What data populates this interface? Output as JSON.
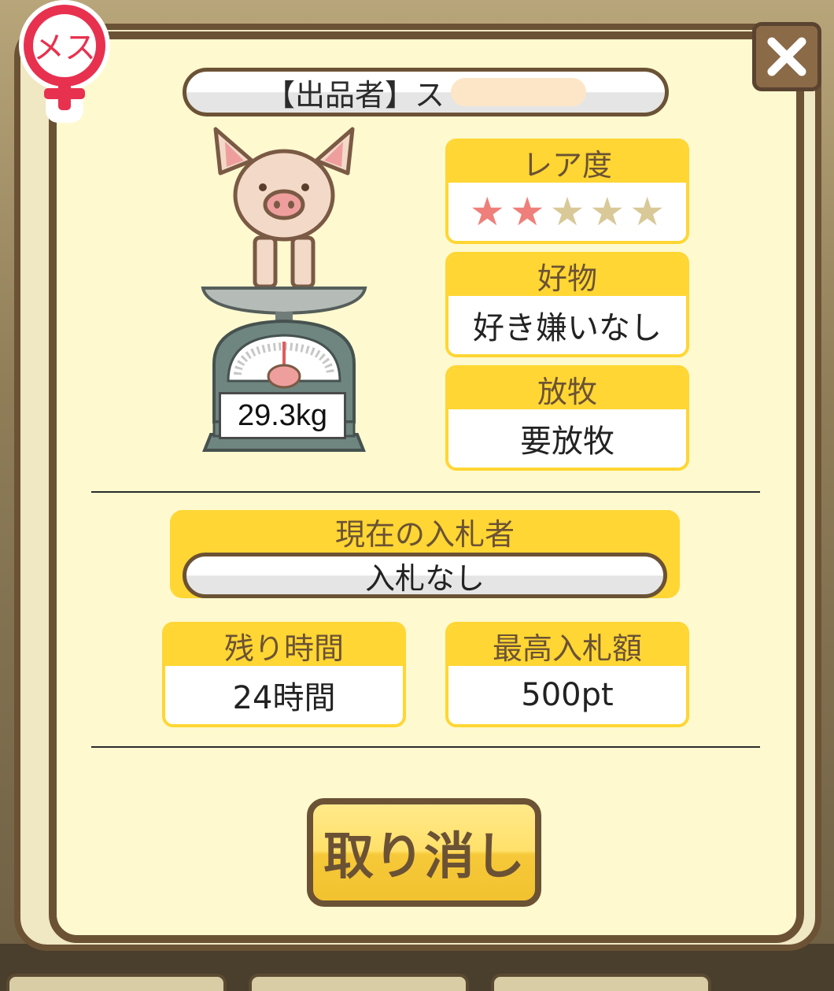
{
  "badge": {
    "label": "メス"
  },
  "seller": {
    "label": "【出品者】ス"
  },
  "weight": "29.3kg",
  "rarity": {
    "title": "レア度",
    "filled": 2,
    "total": 5,
    "star_char": "★"
  },
  "favorite": {
    "title": "好物",
    "value": "好き嫌いなし"
  },
  "grazing": {
    "title": "放牧",
    "value": "要放牧"
  },
  "bidder": {
    "title": "現在の入札者",
    "value": "入札なし"
  },
  "time_left": {
    "title": "残り時間",
    "value": "24時間"
  },
  "max_bid": {
    "title": "最高入札額",
    "value": "500pt"
  },
  "cancel_button": {
    "label": "取り消し"
  },
  "colors": {
    "accent_yellow": "#ffd633",
    "frame_brown": "#6b5235",
    "panel_bg": "#fff9cf",
    "star_on": "#ef7f7a",
    "star_off": "#d9c999",
    "female_red": "#e8314f"
  },
  "icons": {
    "close": "close-icon",
    "female": "female-symbol-icon",
    "pig": "pig-on-scale-illustration"
  }
}
